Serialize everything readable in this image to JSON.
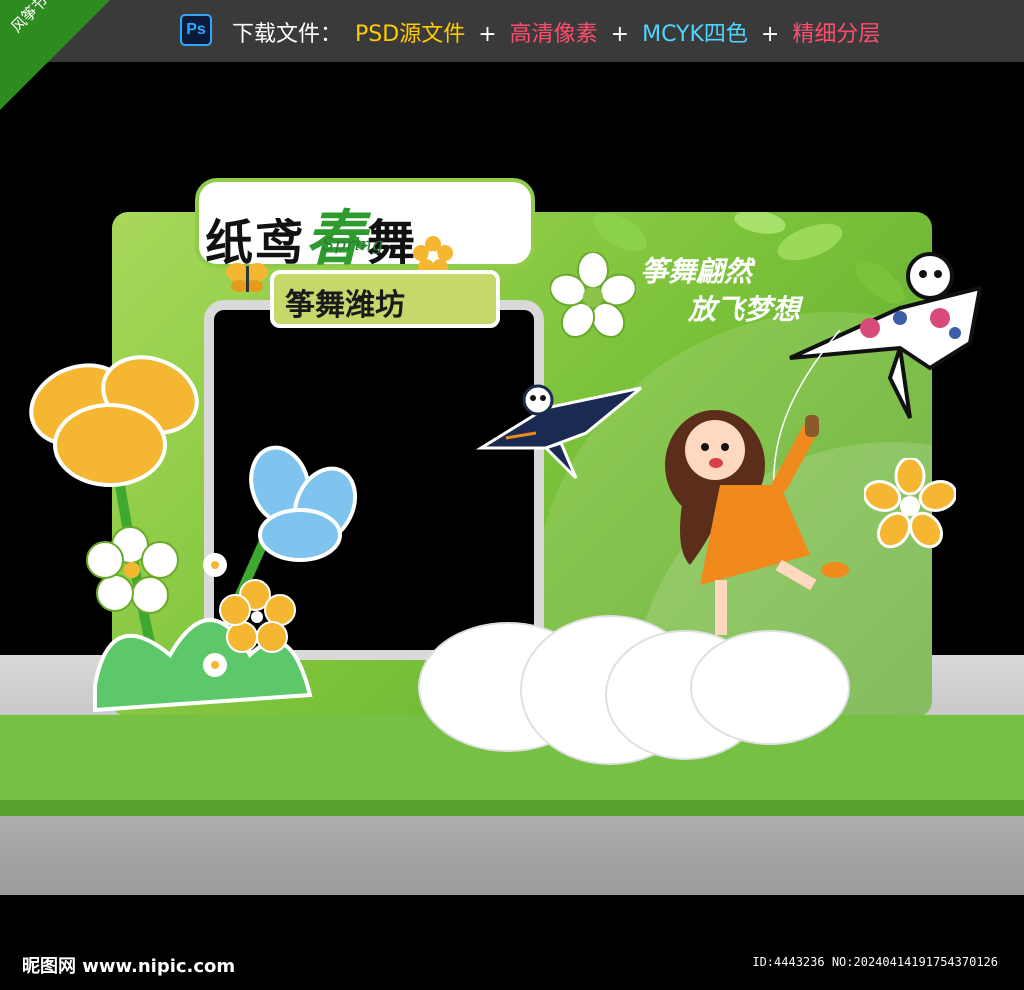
{
  "banner": {
    "corner_label": "风筝节",
    "ps_label": "Ps",
    "download_label": "下载文件：",
    "psd_label": "PSD源文件",
    "plus": "+",
    "hd_label": "高清像素",
    "cmyk_label": "MCYK四色",
    "layers_label": "精细分层"
  },
  "sign": {
    "title_part1": "纸鸢",
    "title_chun": "春",
    "title_part2": "舞",
    "spring_script": "Spring",
    "subtitle": "筝舞潍坊"
  },
  "slogans": {
    "line1": "筝舞翩然",
    "line2": "放飞梦想"
  },
  "footer": {
    "logo": "昵图网 www.nipic.com",
    "id_text": "ID:4443236 NO:20240414191754370126"
  },
  "colors": {
    "green_main": "#7cc33a",
    "green_dark": "#2e9b2e",
    "yellow_flower": "#f5b731",
    "blue_flower": "#7fc4ef",
    "orange_dress": "#f08a1c"
  }
}
